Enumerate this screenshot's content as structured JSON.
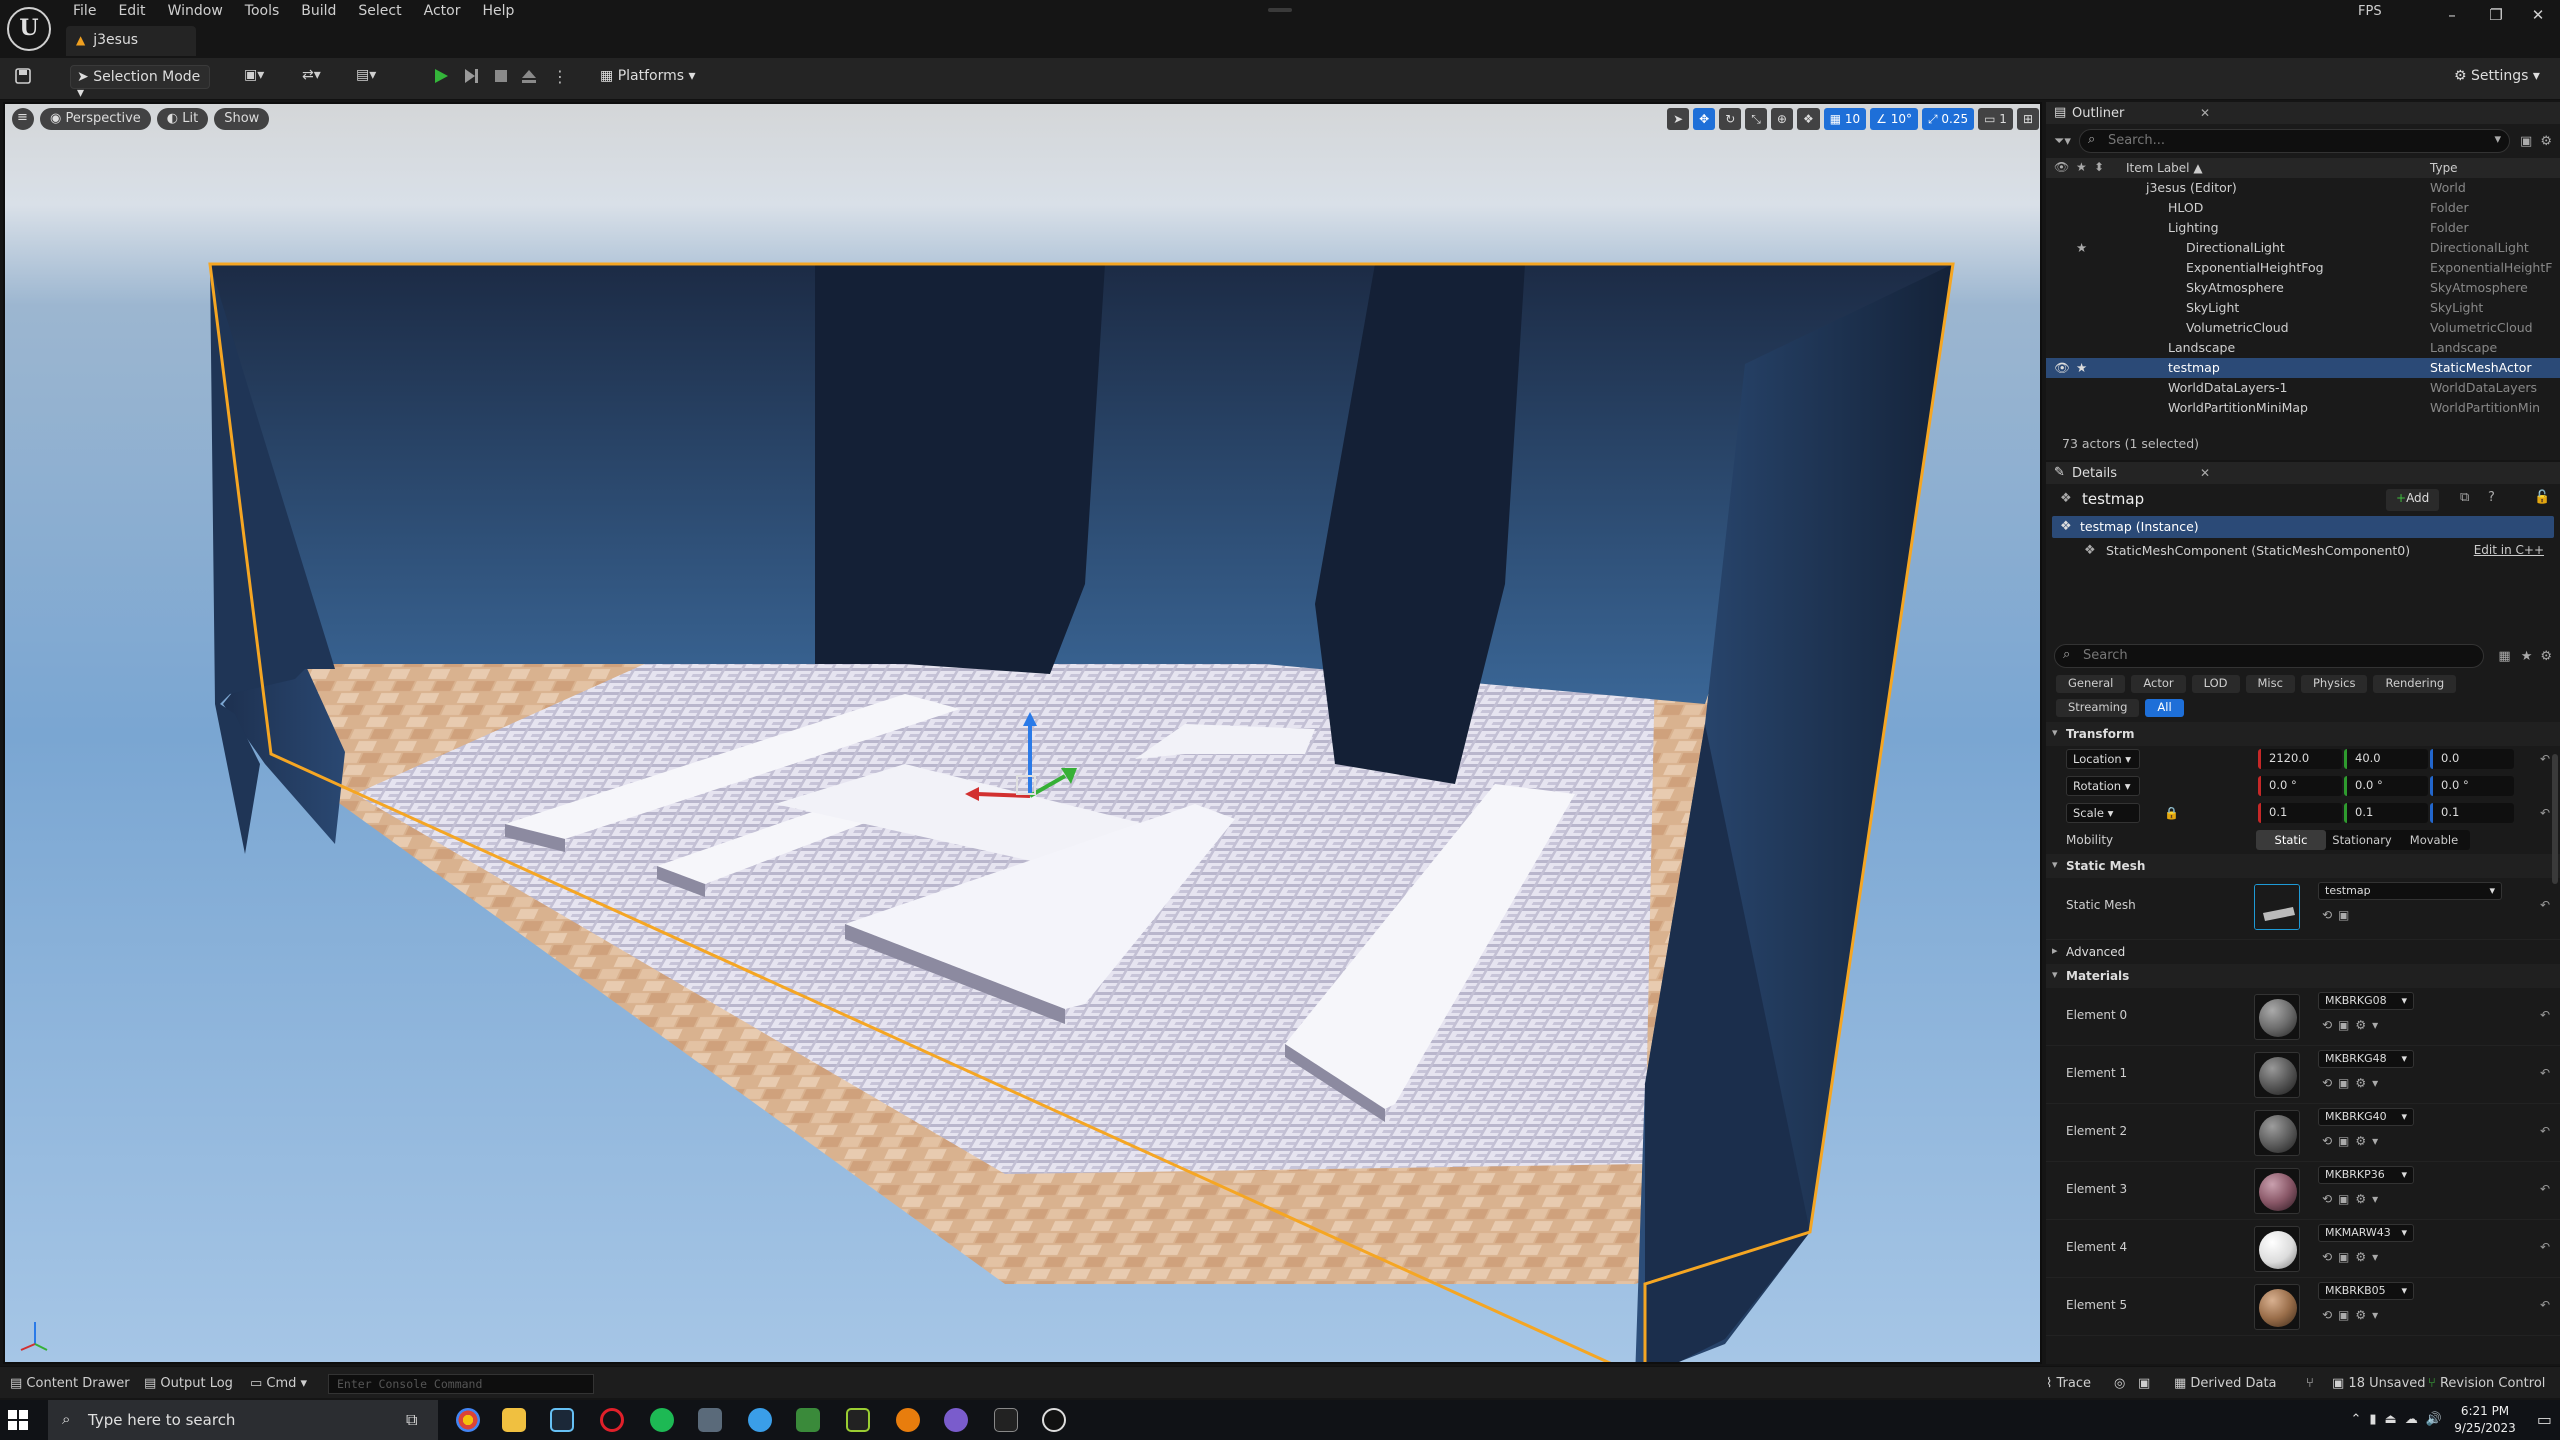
{
  "app": {
    "menu": [
      "File",
      "Edit",
      "Window",
      "Tools",
      "Build",
      "Select",
      "Actor",
      "Help"
    ],
    "doc_tab": "j3esus",
    "fps_label": "FPS"
  },
  "toolbar": {
    "selection_mode": "Selection Mode",
    "platforms": "Platforms",
    "settings": "Settings"
  },
  "viewport": {
    "perspective": "Perspective",
    "lit": "Lit",
    "show": "Show",
    "grid_snap": "10",
    "rot_snap": "10°",
    "scale_snap": "0.25",
    "camera_speed": "1"
  },
  "outliner": {
    "title": "Outliner",
    "search_placeholder": "Search...",
    "col_label": "Item Label ▲",
    "col_type": "Type",
    "rows": [
      {
        "label": "j3esus (Editor)",
        "type": "World"
      },
      {
        "label": "HLOD",
        "type": "Folder"
      },
      {
        "label": "Lighting",
        "type": "Folder"
      },
      {
        "label": "DirectionalLight",
        "type": "DirectionalLight"
      },
      {
        "label": "ExponentialHeightFog",
        "type": "ExponentialHeightF"
      },
      {
        "label": "SkyAtmosphere",
        "type": "SkyAtmosphere"
      },
      {
        "label": "SkyLight",
        "type": "SkyLight"
      },
      {
        "label": "VolumetricCloud",
        "type": "VolumetricCloud"
      },
      {
        "label": "Landscape",
        "type": "Landscape"
      },
      {
        "label": "testmap",
        "type": "StaticMeshActor"
      },
      {
        "label": "WorldDataLayers-1",
        "type": "WorldDataLayers"
      },
      {
        "label": "WorldPartitionMiniMap",
        "type": "WorldPartitionMin"
      }
    ],
    "status": "73 actors (1 selected)"
  },
  "details": {
    "title": "Details",
    "actor_name": "testmap",
    "add_label": "Add",
    "instance_label": "testmap (Instance)",
    "component_label": "StaticMeshComponent (StaticMeshComponent0)",
    "edit_cpp": "Edit in C++",
    "search_placeholder": "Search",
    "filters": [
      "General",
      "Actor",
      "LOD",
      "Misc",
      "Physics",
      "Rendering",
      "Streaming",
      "All"
    ],
    "transform_title": "Transform",
    "location_label": "Location",
    "rotation_label": "Rotation",
    "scale_label": "Scale",
    "location": [
      "2120.0",
      "40.0",
      "0.0"
    ],
    "rotation": [
      "0.0 °",
      "0.0 °",
      "0.0 °"
    ],
    "scale": [
      "0.1",
      "0.1",
      "0.1"
    ],
    "mobility_label": "Mobility",
    "mobility_options": [
      "Static",
      "Stationary",
      "Movable"
    ],
    "static_mesh_title": "Static Mesh",
    "static_mesh_label": "Static Mesh",
    "static_mesh_value": "testmap",
    "advanced_label": "Advanced",
    "materials_title": "Materials",
    "materials": [
      {
        "label": "Element 0",
        "name": "MKBRKG08",
        "color": "#6d6d6d"
      },
      {
        "label": "Element 1",
        "name": "MKBRKG48",
        "color": "#585858"
      },
      {
        "label": "Element 2",
        "name": "MKBRKG40",
        "color": "#5e5e5e"
      },
      {
        "label": "Element 3",
        "name": "MKBRKP36",
        "color": "#8a5868"
      },
      {
        "label": "Element 4",
        "name": "MKMARW43",
        "color": "#dcdcdc"
      },
      {
        "label": "Element 5",
        "name": "MKBRKB05",
        "color": "#9a6e4a"
      }
    ]
  },
  "statusbar": {
    "content_drawer": "Content Drawer",
    "output_log": "Output Log",
    "cmd": "Cmd",
    "console_placeholder": "Enter Console Command",
    "trace": "Trace",
    "derived_data": "Derived Data",
    "unsaved": "18 Unsaved",
    "revision_control": "Revision Control"
  },
  "taskbar": {
    "search_placeholder": "Type here to search",
    "time": "6:21 PM",
    "date": "9/25/2023"
  },
  "colors": {
    "accent": "#1e6fd8",
    "selection": "#2b4a77",
    "selection_outline": "#f5a623"
  }
}
